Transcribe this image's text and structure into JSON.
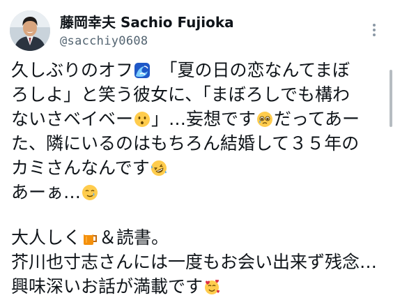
{
  "author": {
    "display_name": "藤岡幸夫 Sachio Fujioka",
    "handle": "@sacchiy0608"
  },
  "icons": {
    "more": "more-vertical-icon",
    "wave": "water-wave-emoji",
    "whistling": "kissing-face-emoji",
    "teary": "face-holding-back-tears-emoji",
    "rolling_laugh": "rolling-on-floor-laughing-emoji",
    "sad_smile": "smiling-face-with-tear-emoji",
    "beer": "beer-mug-emoji",
    "hearts": "smiling-face-with-hearts-emoji"
  },
  "tweet": {
    "line1": "久しぶりのオフ",
    "line1b": "　「夏の日の恋なんてまぼ",
    "line2": "ろしよ」と笑う彼女に、「まぼろしでも構わ",
    "line3a": "ないさベイベー",
    "line3b": "」…妄想です",
    "line3c": "だってあー",
    "line4": "た、隣にいるのはもちろん結婚して３５年の",
    "line5": "カミさんなんです",
    "line6": "あーぁ…",
    "line7a": "大人しく",
    "line7b": "＆読書。",
    "line8": "芥川也寸志さんには一度もお会い出来ず残念…",
    "line9": "興味深いお話が満載です"
  },
  "colors": {
    "text": "#0f1419",
    "secondary_text": "#536471"
  }
}
